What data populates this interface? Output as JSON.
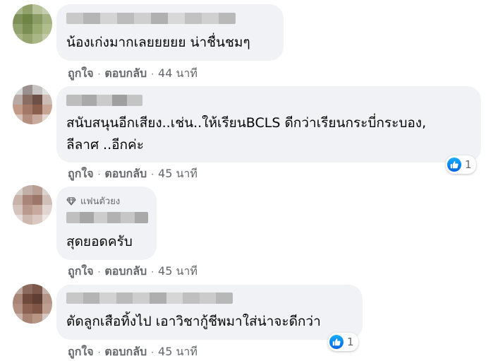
{
  "actions": {
    "like_label": "ถูกใจ",
    "reply_label": "ตอบกลับ",
    "separator": "·"
  },
  "comments": [
    {
      "text_lines": [
        "น้องเก่งมากเลยยยยย น่าชื่นชมๆ"
      ],
      "time": "44 นาที"
    },
    {
      "text_lines": [
        "สนับสนุนอีกเสียง..เช่น..ให้เรียนBCLS ดีกว่าเรียนกระบี่กระบอง,",
        "ลีลาศ ..อีกค่ะ"
      ],
      "time": "45 นาที",
      "reaction": {
        "icon": "like-icon",
        "count": "1"
      }
    },
    {
      "badge": "แฟนตัวยง",
      "text_lines": [
        "สุดยอดครับ"
      ],
      "time": "45 นาที"
    },
    {
      "text_lines": [
        "ตัดลูกเสือทิ้งไป เอาวิชากู้ชีพมาใส่น่าจะดีกว่า"
      ],
      "time": "45 นาที",
      "reaction": {
        "icon": "like-icon",
        "count": "1"
      }
    }
  ],
  "colors": {
    "bubble": "#f0f2f5",
    "meta_text": "#65676b",
    "body_text": "#050505",
    "like_blue": "#1877f2"
  }
}
